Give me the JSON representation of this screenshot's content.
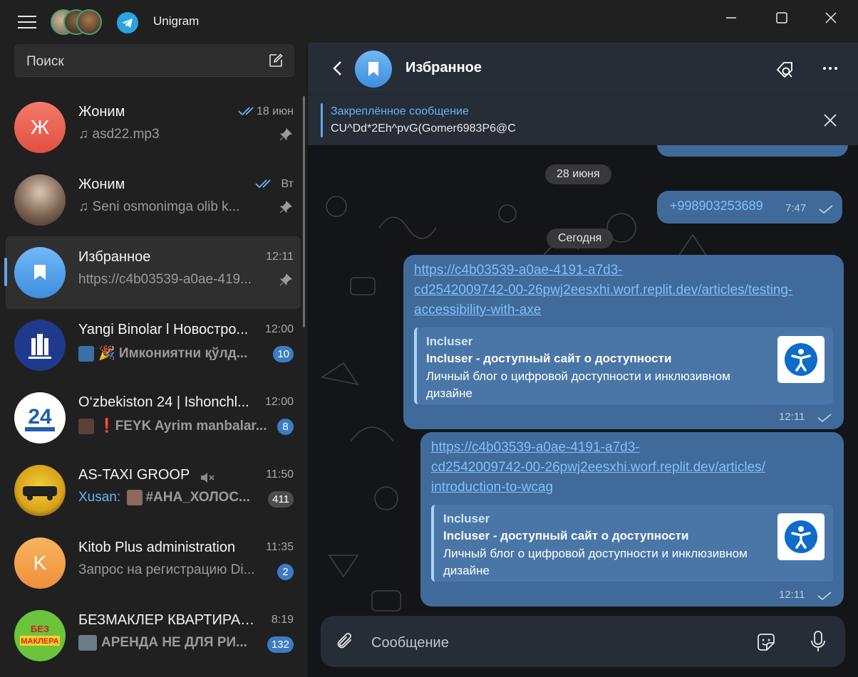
{
  "app": {
    "title": "Unigram"
  },
  "sidebar": {
    "search_label": "Поиск",
    "chats": [
      {
        "title": "Жоним",
        "time": "18 июн",
        "subtitle": "asd22.mp3",
        "avatar_letter": "Ж",
        "pinned": true
      },
      {
        "title": "Жоним",
        "time": "Вт",
        "subtitle": "Seni osmonimga olib k...",
        "pinned": true
      },
      {
        "title": "Избранное",
        "time": "12:11",
        "subtitle": "https://c4b03539-a0ae-419...",
        "pinned": true
      },
      {
        "title": "Yangi Binolar l Новостро...",
        "time": "12:00",
        "subtitle": "🎉 Имкониятни қўлд...",
        "badge": "10"
      },
      {
        "title": "O‘zbekiston 24 | Ishonchl...",
        "time": "12:00",
        "subtitle": "❗FEYK Ayrim manbalar...",
        "badge": "8"
      },
      {
        "title": "AS-TAXI GROOP",
        "time": "11:50",
        "sender": "Xusan:",
        "subtitle": "#АНА_ХОЛОС...",
        "badge": "411"
      },
      {
        "title": "Kitob Plus administration",
        "time": "11:35",
        "subtitle": "Запрос на регистрацию Di...",
        "avatar_letter": "K",
        "badge": "2"
      },
      {
        "title": "БЕЗМАКЛЕР КВАРТИРА |...",
        "time": "8:19",
        "subtitle": "АРЕНДА НЕ ДЛЯ РИ...",
        "badge": "132"
      }
    ]
  },
  "chat": {
    "title": "Избранное",
    "pinned_label": "Закреплённое сообщение",
    "pinned_text": "CU^Dd*2Eh^pvG(Gomer6983P6@C",
    "date_1": "28 июня",
    "phone": "+998903253689",
    "phone_time": "7:47",
    "date_2": "Сегодня",
    "messages": [
      {
        "link_lines": [
          "https://c4b03539-a0ae-4191-a7d3-",
          "cd2542009742-00-26pwj2eesxhi.worf.replit.dev/articles/testing-",
          "accessibility-with-axe"
        ],
        "site": "Incluser",
        "preview_title": "Incluser - доступный сайт о доступности",
        "preview_desc": "Личный блог о цифровой доступности и инклюзивном дизайне",
        "time": "12:11"
      },
      {
        "link_lines": [
          "https://c4b03539-a0ae-4191-a7d3-",
          "cd2542009742-00-26pwj2eesxhi.worf.replit.dev/articles/",
          "introduction-to-wcag"
        ],
        "site": "Incluser",
        "preview_title": "Incluser - доступный сайт о доступности",
        "preview_desc": "Личный блог о цифровой доступности и инклюзивном дизайне",
        "time": "12:11"
      }
    ],
    "composer_placeholder": "Сообщение"
  }
}
